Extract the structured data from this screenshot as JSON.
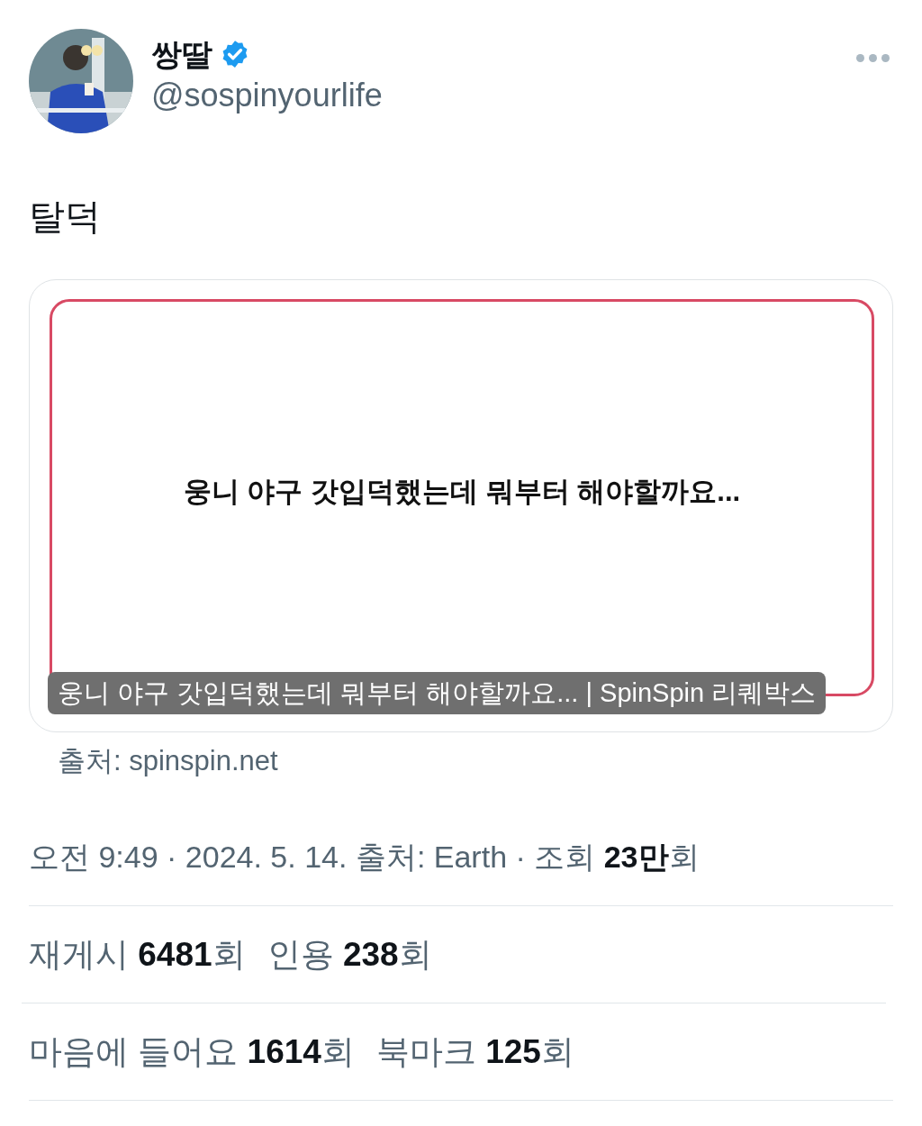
{
  "author": {
    "name": "쌍딸",
    "verified": true,
    "handle": "@sospinyourlife"
  },
  "tweet": {
    "text": "탈덕"
  },
  "link_card": {
    "image_text": "웅니 야구 갓입덕했는데 뭐부터 해야할까요...",
    "caption": "웅니 야구 갓입덕했는데 뭐부터 해야할까요... | SpinSpin 리퀘박스",
    "source": "출처: spinspin.net"
  },
  "meta": "오전 9:49 · 2024. 5. 14. 출처: Earth · 조회 **23만**회",
  "stat_rows": [
    [
      {
        "label": "재게시 **6481**회"
      },
      {
        "label": "인용 **238**회"
      }
    ],
    [
      {
        "label": "마음에 들어요 **1614**회"
      },
      {
        "label": "북마크 **125**회"
      }
    ]
  ]
}
